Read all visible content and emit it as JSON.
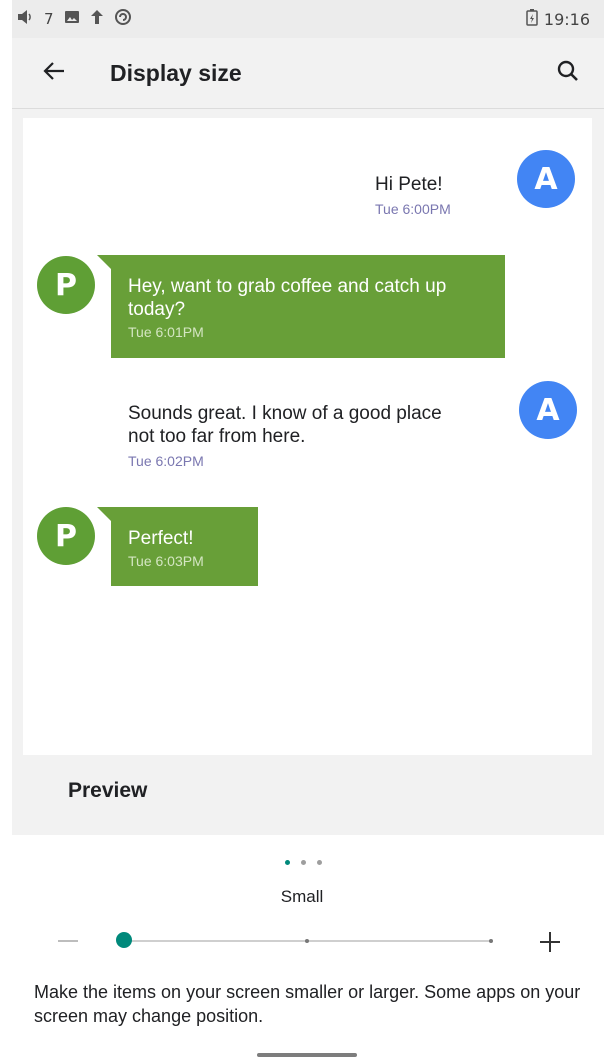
{
  "status_bar": {
    "volume_icon": "volume-icon",
    "notification_count": "7",
    "gallery_icon": "image-icon",
    "upload_icon": "upload-arrow-icon",
    "sync_icon": "sync-icon",
    "battery_icon": "battery-icon",
    "time": "19:16"
  },
  "app_bar": {
    "back_icon": "arrow-back-icon",
    "title": "Display size",
    "search_icon": "search-icon"
  },
  "preview": {
    "messages": [
      {
        "sender": "A",
        "text": "Hi Pete!",
        "time": "Tue 6:00PM"
      },
      {
        "sender": "P",
        "text": "Hey, want to grab coffee and catch up today?",
        "time": "Tue 6:01PM"
      },
      {
        "sender": "A",
        "text": "Sounds great. I know of a good place not too far from here.",
        "time": "Tue 6:02PM"
      },
      {
        "sender": "P",
        "text": "Perfect!",
        "time": "Tue 6:03PM"
      }
    ],
    "label": "Preview"
  },
  "size_control": {
    "page_indicator": {
      "count": 3,
      "active_index": 0
    },
    "size_label": "Small",
    "slider": {
      "steps": 3,
      "selected_index": 0
    },
    "minus_icon": "minus-icon",
    "plus_icon": "plus-icon",
    "description": "Make the items on your screen smaller or larger. Some apps on your screen may change position."
  },
  "colors": {
    "accent": "#00897b",
    "avatar_a": "#4285f4",
    "avatar_p": "#5f9f35",
    "bubble_green": "#689f38",
    "timestamp": "#7a77b0"
  }
}
